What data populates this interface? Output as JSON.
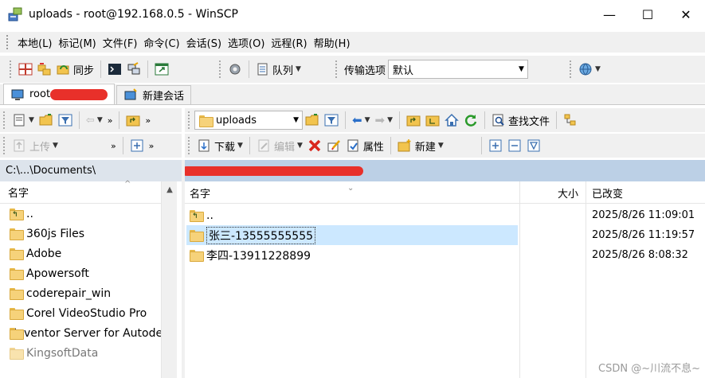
{
  "window": {
    "title": "uploads - root@192.168.0.5 - WinSCP",
    "minimize": "—",
    "maximize": "☐",
    "close": "✕"
  },
  "menu": [
    "本地(L)",
    "标记(M)",
    "文件(F)",
    "命令(C)",
    "会话(S)",
    "选项(O)",
    "远程(R)",
    "帮助(H)"
  ],
  "toolbar": {
    "sync_label": "同步",
    "queue_label": "队列",
    "transfer_label": "传输选项",
    "transfer_value": "默认"
  },
  "tabs": {
    "session_label": "root@192.",
    "new_session_label": "新建会话"
  },
  "left_pane": {
    "path": "C:\\...\\Documents\\",
    "upload_label": "上传",
    "column_name": "名字",
    "items": [
      {
        "name": "..",
        "type": "up"
      },
      {
        "name": "360js Files",
        "type": "folder"
      },
      {
        "name": "Adobe",
        "type": "folder"
      },
      {
        "name": "Apowersoft",
        "type": "folder"
      },
      {
        "name": "coderepair_win",
        "type": "folder"
      },
      {
        "name": "Corel VideoStudio Pro",
        "type": "folder"
      },
      {
        "name": "Inventor Server for Autodesk",
        "type": "folder"
      },
      {
        "name": "KingsoftData",
        "type": "folder"
      }
    ]
  },
  "right_pane": {
    "dir_combo": "uploads",
    "find_files_label": "查找文件",
    "download_label": "下载",
    "edit_label": "编辑",
    "properties_label": "属性",
    "new_label": "新建",
    "columns": {
      "name": "名字",
      "size": "大小",
      "modified": "已改变"
    },
    "items": [
      {
        "name": "..",
        "type": "up",
        "modified": "2025/8/26 11:09:01"
      },
      {
        "name": "张三-13555555555",
        "type": "folder",
        "modified": "2025/8/26 11:19:57",
        "selected": true
      },
      {
        "name": "李四-13911228899",
        "type": "folder",
        "modified": "2025/8/26 8:08:32"
      }
    ]
  },
  "watermark": "CSDN @~川流不息~",
  "colors": {
    "selection": "#cce8ff",
    "remote_path_bar": "#bcd0e6",
    "local_path_bar": "#dde4ec",
    "redaction": "#e8302a"
  }
}
